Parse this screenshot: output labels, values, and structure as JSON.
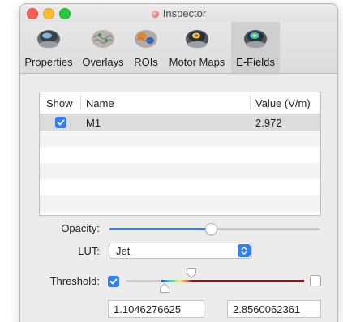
{
  "window": {
    "title": "Inspector"
  },
  "toolbar": {
    "items": [
      {
        "label": "Properties",
        "icon": "properties-icon"
      },
      {
        "label": "Overlays",
        "icon": "overlays-icon"
      },
      {
        "label": "ROIs",
        "icon": "rois-icon"
      },
      {
        "label": "Motor Maps",
        "icon": "motor-maps-icon"
      },
      {
        "label": "E-Fields",
        "icon": "e-fields-icon",
        "selected": true
      }
    ]
  },
  "table": {
    "columns": [
      "Show",
      "Name",
      "Value (V/m)"
    ],
    "rows": [
      {
        "show": true,
        "name": "M1",
        "value": "2.972"
      }
    ]
  },
  "opacity": {
    "label": "Opacity:",
    "value": 0.48
  },
  "lut": {
    "label": "LUT:",
    "selected": "Jet"
  },
  "threshold": {
    "label": "Threshold:",
    "enabled": true,
    "upper_enabled": false,
    "low_value": "1.1046276625",
    "high_value": "2.8560062361",
    "low_position": 0.22,
    "high_position": 0.37
  },
  "colors": {
    "accent": "#2f7ff5",
    "threshold_band": "#a01010"
  }
}
